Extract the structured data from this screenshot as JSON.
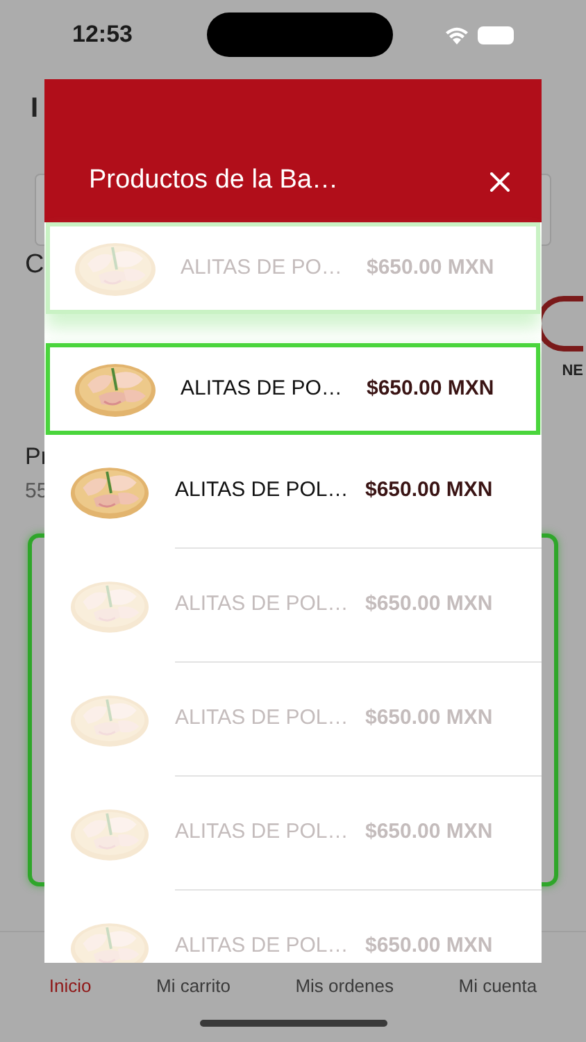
{
  "status_bar": {
    "time": "12:53"
  },
  "background": {
    "title": "I",
    "section_label": "C",
    "logo_text": "NE",
    "products_label": "Pr",
    "products_count": "55"
  },
  "modal": {
    "title": "Productos de la Ba…",
    "items": [
      {
        "name": "ALITAS DE PO…",
        "price": "$650.00 MXN",
        "outlined": true,
        "faded": true
      },
      {
        "name": "ALITAS DE PO…",
        "price": "$650.00 MXN",
        "outlined": true,
        "faded": false
      },
      {
        "name": "ALITAS DE POL…",
        "price": "$650.00 MXN",
        "outlined": false,
        "faded": false
      },
      {
        "name": "ALITAS DE POL…",
        "price": "$650.00 MXN",
        "outlined": false,
        "faded": true
      },
      {
        "name": "ALITAS DE POL…",
        "price": "$650.00 MXN",
        "outlined": false,
        "faded": true
      },
      {
        "name": "ALITAS DE POL…",
        "price": "$650.00 MXN",
        "outlined": false,
        "faded": true
      },
      {
        "name": "ALITAS DE POL…",
        "price": "$650.00 MXN",
        "outlined": false,
        "faded": true
      }
    ]
  },
  "tabs": [
    {
      "label": "Inicio",
      "selected": true
    },
    {
      "label": "Mi carrito",
      "selected": false
    },
    {
      "label": "Mis ordenes",
      "selected": false
    },
    {
      "label": "Mi cuenta",
      "selected": false
    }
  ]
}
